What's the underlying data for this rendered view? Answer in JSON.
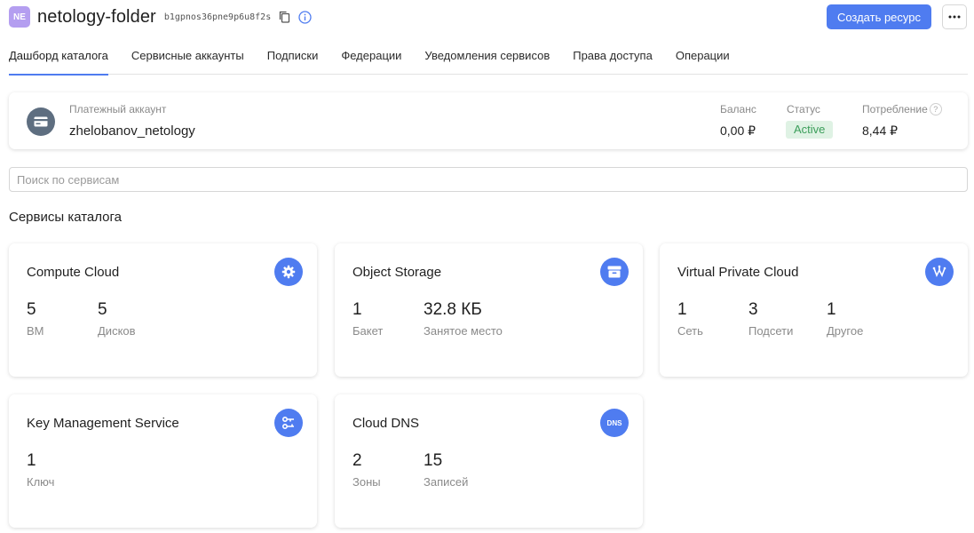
{
  "header": {
    "badge": "NE",
    "title": "netology-folder",
    "folder_id": "b1gpnos36pne9p6u8f2s",
    "create_button": "Создать ресурс"
  },
  "tabs": [
    {
      "label": "Дашборд каталога",
      "active": true
    },
    {
      "label": "Сервисные аккаунты"
    },
    {
      "label": "Подписки"
    },
    {
      "label": "Федерации"
    },
    {
      "label": "Уведомления сервисов"
    },
    {
      "label": "Права доступа"
    },
    {
      "label": "Операции"
    }
  ],
  "billing": {
    "label": "Платежный аккаунт",
    "name": "zhelobanov_netology",
    "balance_label": "Баланс",
    "balance_value": "0,00 ₽",
    "status_label": "Статус",
    "status_value": "Active",
    "consumption_label": "Потребление",
    "consumption_value": "8,44 ₽"
  },
  "search": {
    "placeholder": "Поиск по сервисам"
  },
  "section_title": "Сервисы каталога",
  "services": [
    {
      "title": "Compute Cloud",
      "icon": "gear-icon",
      "metrics": [
        {
          "value": "5",
          "label": "ВМ"
        },
        {
          "value": "5",
          "label": "Дисков"
        }
      ]
    },
    {
      "title": "Object Storage",
      "icon": "storage-box-icon",
      "metrics": [
        {
          "value": "1",
          "label": "Бакет"
        },
        {
          "value": "32.8 КБ",
          "label": "Занятое место"
        }
      ]
    },
    {
      "title": "Virtual Private Cloud",
      "icon": "network-icon",
      "metrics": [
        {
          "value": "1",
          "label": "Сеть"
        },
        {
          "value": "3",
          "label": "Подсети"
        },
        {
          "value": "1",
          "label": "Другое"
        }
      ]
    },
    {
      "title": "Key Management Service",
      "icon": "key-icon",
      "metrics": [
        {
          "value": "1",
          "label": "Ключ"
        }
      ]
    },
    {
      "title": "Cloud DNS",
      "icon": "dns-icon",
      "icon_text": "DNS",
      "metrics": [
        {
          "value": "2",
          "label": "Зоны"
        },
        {
          "value": "15",
          "label": "Записей"
        }
      ]
    }
  ],
  "colors": {
    "accent": "#4f7cf0",
    "badge": "#b49ef0",
    "status_bg": "#dff2e4",
    "status_text": "#3b9e5a"
  }
}
